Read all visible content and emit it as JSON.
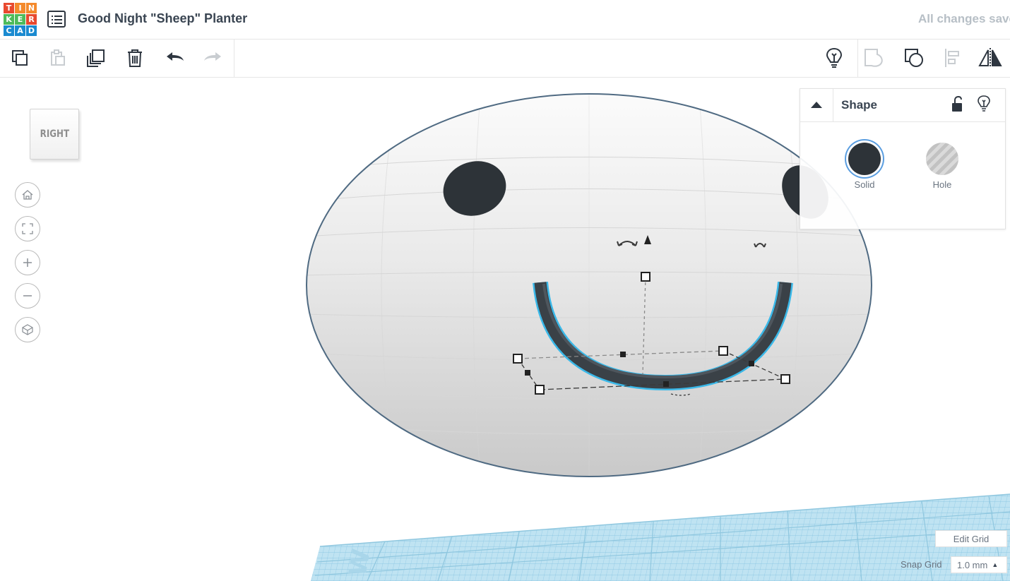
{
  "app": {
    "logo_letters": [
      "T",
      "I",
      "N",
      "K",
      "E",
      "R",
      "C",
      "A",
      "D"
    ],
    "document_title": "Good Night \"Sheep\" Planter",
    "save_status": "All changes saved"
  },
  "toolbar": {
    "left_icons": [
      "copy-icon",
      "paste-icon",
      "duplicate-icon",
      "delete-icon",
      "undo-icon",
      "redo-icon"
    ],
    "right_icons": [
      "show-all-icon",
      "group-icon",
      "ungroup-icon",
      "align-icon",
      "mirror-icon"
    ]
  },
  "viewcube": {
    "face_label": "RIGHT"
  },
  "nav_controls": [
    "home-view-icon",
    "fit-view-icon",
    "zoom-in-icon",
    "zoom-out-icon",
    "perspective-icon"
  ],
  "shape_panel": {
    "title": "Shape",
    "options": [
      {
        "label": "Solid",
        "selected": true,
        "color": "#2d3338"
      },
      {
        "label": "Hole",
        "selected": false
      }
    ]
  },
  "grid_controls": {
    "edit_grid_label": "Edit Grid",
    "snap_grid_label": "Snap Grid",
    "snap_grid_value": "1.0 mm"
  },
  "colors": {
    "accent_selection": "#3ab8e8",
    "workplane": "#9fd3ea",
    "shape_body": "#e4e4e4",
    "shape_features": "#2d3338"
  }
}
